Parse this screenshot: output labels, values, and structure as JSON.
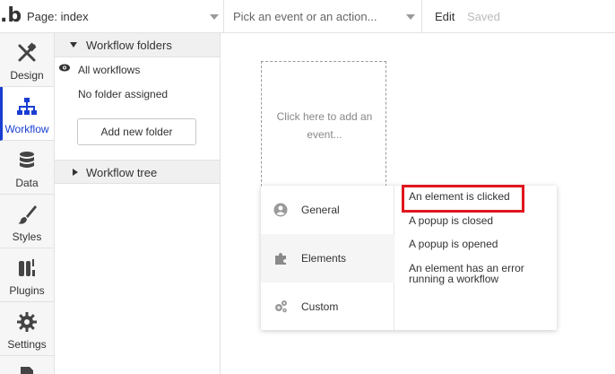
{
  "topbar": {
    "logo": ".b",
    "page_selector": "Page: index",
    "event_picker_placeholder": "Pick an event or an action...",
    "edit_label": "Edit",
    "saved_label": "Saved"
  },
  "sidebar": {
    "items": [
      {
        "label": "Design",
        "icon": "design-icon"
      },
      {
        "label": "Workflow",
        "icon": "workflow-icon",
        "active": true
      },
      {
        "label": "Data",
        "icon": "data-icon"
      },
      {
        "label": "Styles",
        "icon": "styles-icon"
      },
      {
        "label": "Plugins",
        "icon": "plugins-icon"
      },
      {
        "label": "Settings",
        "icon": "settings-icon"
      }
    ]
  },
  "folders_panel": {
    "header": "Workflow folders",
    "items": [
      "All workflows",
      "No folder assigned"
    ],
    "add_button": "Add new folder",
    "tree_header": "Workflow tree"
  },
  "canvas": {
    "event_slot_text": "Click here to add an event..."
  },
  "event_menu": {
    "categories": [
      {
        "label": "General",
        "icon": "general-icon"
      },
      {
        "label": "Elements",
        "icon": "elements-icon",
        "selected": true
      },
      {
        "label": "Custom",
        "icon": "custom-icon"
      }
    ],
    "options": [
      "An element is clicked",
      "A popup is closed",
      "A popup is opened",
      "An element has an error running a workflow"
    ],
    "highlight_color": "#e0161e"
  },
  "colors": {
    "accent": "#1a3ed1",
    "border": "#e2e2e2"
  }
}
